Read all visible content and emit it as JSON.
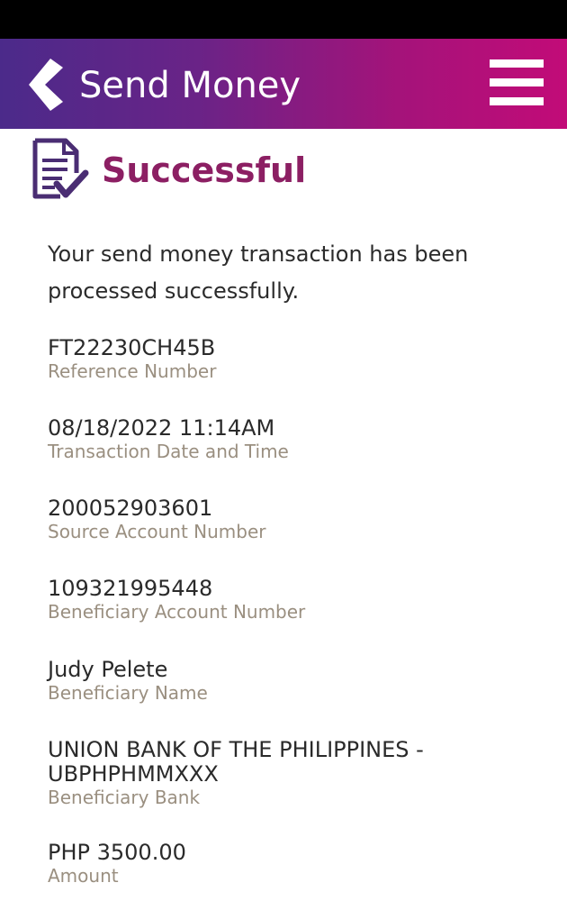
{
  "header": {
    "title": "Send Money",
    "back_icon": "chevron-left-icon",
    "menu_icon": "hamburger-menu-icon",
    "gradient_start": "#4b2a8a",
    "gradient_end": "#c20b78"
  },
  "status": {
    "icon": "document-check-icon",
    "title": "Successful",
    "title_color": "#8c1f63",
    "message": "Your send money transaction has been processed successfully."
  },
  "details": [
    {
      "value": "FT22230CH45B",
      "label": "Reference Number"
    },
    {
      "value": "08/18/2022 11:14AM",
      "label": "Transaction Date and Time"
    },
    {
      "value": "200052903601",
      "label": "Source Account Number"
    },
    {
      "value": "109321995448",
      "label": "Beneficiary Account Number"
    },
    {
      "value": "Judy Pelete",
      "label": "Beneficiary Name"
    },
    {
      "value": "UNION BANK OF THE PHILIPPINES - UBPHPHMMXXX",
      "label": "Beneficiary Bank"
    },
    {
      "value": "PHP 3500.00",
      "label": "Amount"
    }
  ],
  "colors": {
    "label": "#9a8f80",
    "value": "#2a2a2a",
    "icon": "#4a2d73"
  }
}
